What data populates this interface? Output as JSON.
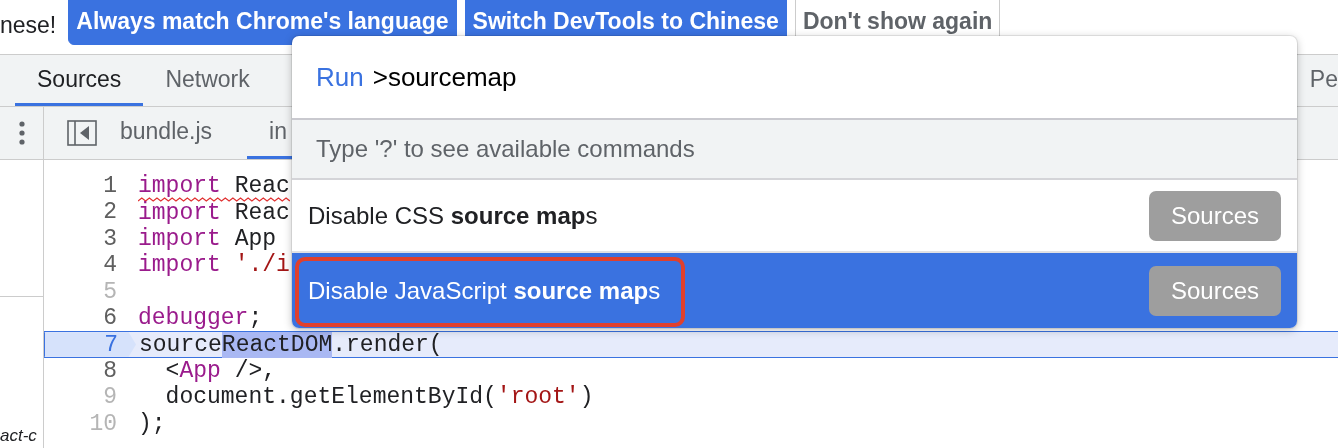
{
  "infobar": {
    "lead_text": "nese!",
    "buttons": [
      {
        "label": "Always match Chrome's language",
        "kind": "primary"
      },
      {
        "label": "Switch DevTools to Chinese",
        "kind": "primary"
      },
      {
        "label": "Don't show again",
        "kind": "secondary"
      }
    ]
  },
  "main_tabs": [
    {
      "label": "Sources",
      "selected": true
    },
    {
      "label": "Network",
      "selected": false
    },
    {
      "label": "Pe",
      "selected": false
    }
  ],
  "file_tabs": [
    {
      "label": "bundle.js",
      "selected": false
    },
    {
      "label": "in",
      "selected": true
    }
  ],
  "navigator": {
    "text": "act-c"
  },
  "code_lines": [
    {
      "number": "1",
      "dim": false,
      "error": true,
      "current": false,
      "tokens": [
        {
          "kind": "keyword",
          "text": "import"
        },
        {
          "kind": "plain",
          "text": " Reac"
        }
      ]
    },
    {
      "number": "2",
      "dim": false,
      "current": false,
      "tokens": [
        {
          "kind": "keyword",
          "text": "import"
        },
        {
          "kind": "plain",
          "text": " Reac"
        }
      ]
    },
    {
      "number": "3",
      "dim": false,
      "current": false,
      "tokens": [
        {
          "kind": "keyword",
          "text": "import"
        },
        {
          "kind": "plain",
          "text": " App"
        }
      ]
    },
    {
      "number": "4",
      "dim": false,
      "current": false,
      "tokens": [
        {
          "kind": "keyword",
          "text": "import"
        },
        {
          "kind": "string",
          "text": " './i"
        }
      ]
    },
    {
      "number": "5",
      "dim": true,
      "current": false
    },
    {
      "number": "6",
      "dim": false,
      "current": false,
      "tokens": [
        {
          "kind": "keyword",
          "text": "debugger"
        },
        {
          "kind": "plain",
          "text": ";"
        }
      ]
    },
    {
      "number": "7",
      "dim": false,
      "current": true,
      "tokens": [
        {
          "kind": "plain",
          "text": "source"
        },
        {
          "kind": "selection",
          "text": "ReactDOM"
        },
        {
          "kind": "plain",
          "text": ".render("
        }
      ]
    },
    {
      "number": "8",
      "dim": false,
      "current": false,
      "tokens": [
        {
          "kind": "plain",
          "text": "  <"
        },
        {
          "kind": "keyword",
          "text": "App"
        },
        {
          "kind": "plain",
          "text": " />,"
        }
      ]
    },
    {
      "number": "9",
      "dim": true,
      "current": false,
      "tokens": [
        {
          "kind": "plain",
          "text": "  document.getElementById("
        },
        {
          "kind": "string",
          "text": "'root'"
        },
        {
          "kind": "plain",
          "text": ")"
        }
      ]
    },
    {
      "number": "10",
      "dim": true,
      "current": false,
      "tokens": [
        {
          "kind": "plain",
          "text": ");"
        }
      ]
    }
  ],
  "palette": {
    "prefix": "Run",
    "query": ">sourcemap",
    "hint": "Type '?' to see available commands",
    "items": [
      {
        "text": "Disable CSS **source map**s",
        "badge": "Sources",
        "selected": false,
        "annotated": false
      },
      {
        "text": "Disable JavaScript **source** **map**s",
        "badge": "Sources",
        "selected": true,
        "annotated": true
      }
    ]
  }
}
